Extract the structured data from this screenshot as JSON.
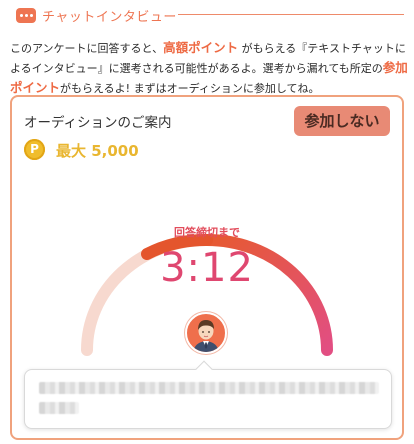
{
  "header": {
    "title": "チャットインタビュー",
    "icon": "chat-bubble-icon",
    "accent_color": "#ee7552"
  },
  "intro": {
    "part1": "このアンケートに回答すると、",
    "highlight1": "高額ポイント",
    "part2": " がもらえる『テキストチャットによるインタビュー』に選考される可能性があるよ。選考から漏れても所定の",
    "highlight2": "参加ポイント",
    "part3": "がもらえるよ! まずはオーディションに参加してね。"
  },
  "card": {
    "title": "オーディションのご案内",
    "decline_label": "参加しない",
    "coin_letter": "P",
    "reward_label": "最大 5,000",
    "countdown_label": "回答締切まで",
    "countdown_time": "3:12",
    "countdown_progress": 0.5,
    "gauge_colors": {
      "start": "#e65a30",
      "end": "#e24e82",
      "track": "#f7d9cf"
    },
    "avatar_icon": "interviewer-avatar-icon",
    "message_blurred": true
  }
}
